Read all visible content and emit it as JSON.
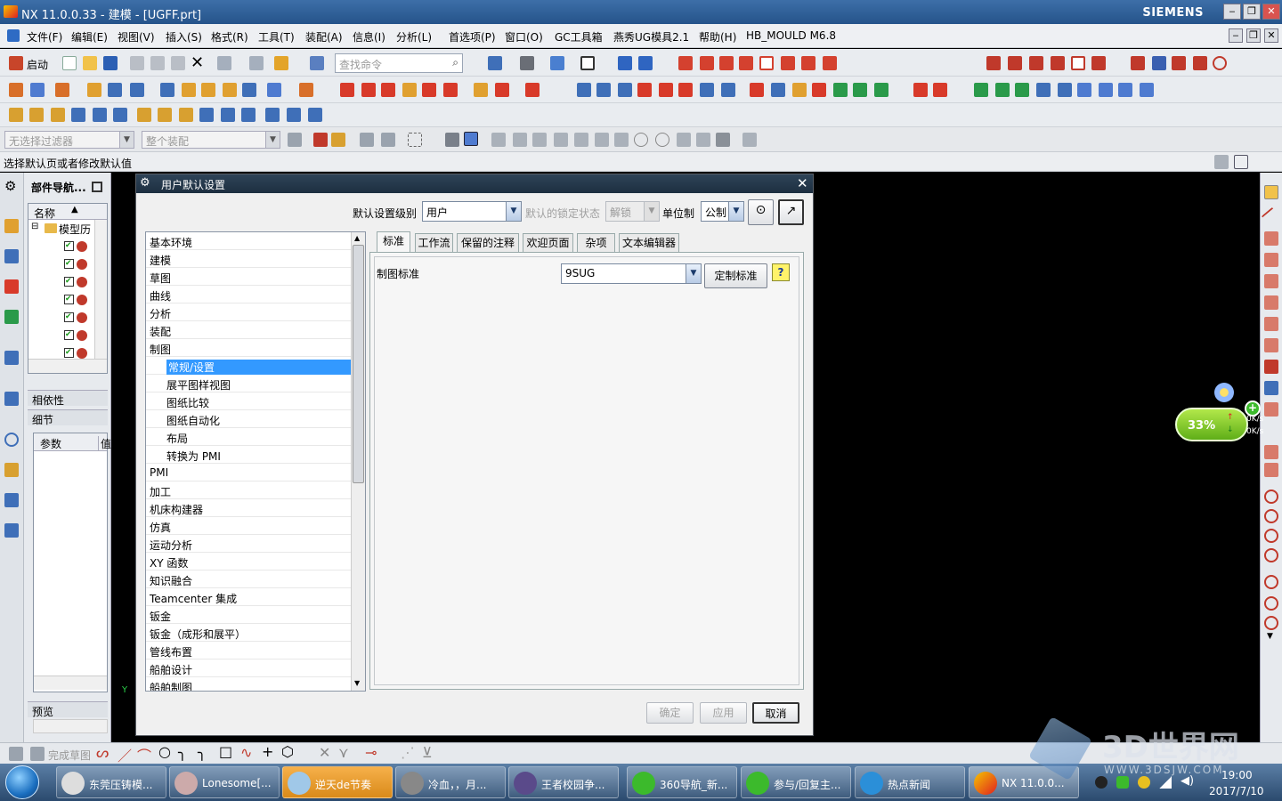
{
  "window": {
    "title": "NX 11.0.0.33 - 建模 - [UGFF.prt]",
    "brand": "SIEMENS"
  },
  "menu": [
    "文件(F)",
    "编辑(E)",
    "视图(V)",
    "插入(S)",
    "格式(R)",
    "工具(T)",
    "装配(A)",
    "信息(I)",
    "分析(L)",
    "首选项(P)",
    "窗口(O)",
    "GC工具箱",
    "燕秀UG模具2.1",
    "帮助(H)",
    "HB_MOULD M6.8"
  ],
  "toolbar": {
    "start_label": "启动",
    "search_placeholder": "查找命令"
  },
  "filterbar": {
    "selection_filter": "无选择过滤器",
    "assembly_scope": "整个装配"
  },
  "statusbar": {
    "message": "选择默认页或者修改默认值"
  },
  "navigator": {
    "title": "部件导航...",
    "col_name": "名称",
    "root": "模型历",
    "dependency": "相依性",
    "details": "细节",
    "param_col": "参数",
    "value_col": "值",
    "preview": "预览"
  },
  "dialog": {
    "title": "用户默认设置",
    "level_label": "默认设置级别",
    "level_value": "用户",
    "lock_label": "默认的锁定状态",
    "lock_value": "解锁",
    "unit_label": "单位制",
    "unit_value": "公制",
    "categories": [
      {
        "label": "基本环境",
        "level": 0
      },
      {
        "label": "建模",
        "level": 0
      },
      {
        "label": "草图",
        "level": 0
      },
      {
        "label": "曲线",
        "level": 0
      },
      {
        "label": "分析",
        "level": 0
      },
      {
        "label": "装配",
        "level": 0
      },
      {
        "label": "制图",
        "level": 0
      },
      {
        "label": "常规/设置",
        "level": 1,
        "selected": true
      },
      {
        "label": "展平图样视图",
        "level": 1
      },
      {
        "label": "图纸比较",
        "level": 1
      },
      {
        "label": "图纸自动化",
        "level": 1
      },
      {
        "label": "布局",
        "level": 1
      },
      {
        "label": "转换为 PMI",
        "level": 1
      },
      {
        "label": "PMI",
        "level": 0
      },
      {
        "label": "加工",
        "level": 0
      },
      {
        "label": "机床构建器",
        "level": 0
      },
      {
        "label": "仿真",
        "level": 0
      },
      {
        "label": "运动分析",
        "level": 0
      },
      {
        "label": "XY 函数",
        "level": 0
      },
      {
        "label": "知识融合",
        "level": 0
      },
      {
        "label": "Teamcenter 集成",
        "level": 0
      },
      {
        "label": "钣金",
        "level": 0
      },
      {
        "label": "钣金（成形和展平）",
        "level": 0
      },
      {
        "label": "管线布置",
        "level": 0
      },
      {
        "label": "船舶设计",
        "level": 0
      },
      {
        "label": "船舶制图",
        "level": 0
      }
    ],
    "tabs": [
      "标准",
      "工作流",
      "保留的注释",
      "欢迎页面",
      "杂项",
      "文本编辑器"
    ],
    "standard_label": "制图标准",
    "standard_value": "9SUG",
    "customize_button": "定制标准",
    "help_icon": "?",
    "ok_button": "确定",
    "apply_button": "应用",
    "cancel_button": "取消"
  },
  "bottom_toolbar": {
    "finish_sketch": "完成草图"
  },
  "speed_widget": {
    "percent": "33%",
    "up": "0K/s",
    "down": "0K/s"
  },
  "taskbar": {
    "items": [
      "东莞压铸模...",
      "Lonesome[...",
      "逆天de节奏",
      "冷血，，月...",
      "王者校园争...",
      "360导航_新...",
      "参与/回复主...",
      "热点新闻",
      "NX 11.0.0..."
    ],
    "time": "19:00",
    "date": "2017/7/10"
  },
  "watermark": {
    "name": "3D世界网",
    "url": "WWW.3DSJW.COM"
  },
  "colors": {
    "title_bar": "#25538a",
    "selection": "#3399ff",
    "graphics_bg": "#000000",
    "dialog_title": "#1d2f40"
  }
}
